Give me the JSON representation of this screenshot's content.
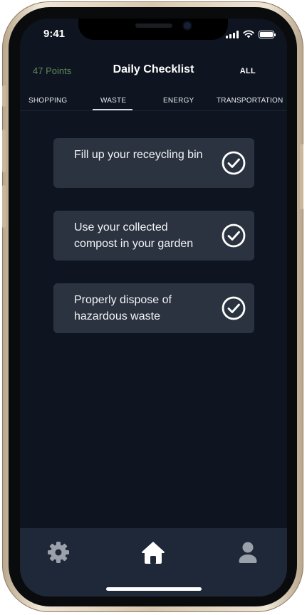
{
  "status_bar": {
    "time": "9:41"
  },
  "header": {
    "points": "47 Points",
    "title": "Daily Checklist",
    "all_label": "ALL"
  },
  "tabs": [
    {
      "label": "SHOPPING",
      "active": false
    },
    {
      "label": "WASTE",
      "active": true
    },
    {
      "label": "ENERGY",
      "active": false
    },
    {
      "label": "TRANSPORTATION",
      "active": false
    }
  ],
  "checklist": [
    {
      "text": "Fill up your receycling bin",
      "icon": "check-circle-icon"
    },
    {
      "text": "Use your collected compost in your garden",
      "icon": "check-circle-icon"
    },
    {
      "text": "Properly dispose of hazardous waste",
      "icon": "check-circle-icon"
    }
  ],
  "tabbar": [
    {
      "icon": "gear-icon"
    },
    {
      "icon": "home-icon",
      "active": true
    },
    {
      "icon": "user-icon"
    }
  ],
  "colors": {
    "background": "#0e1420",
    "card": "#2c3340",
    "tabbar": "#1f2838",
    "points": "#5f8a5a",
    "inactive_icon": "#9aa1ab",
    "active_icon": "#ffffff"
  }
}
